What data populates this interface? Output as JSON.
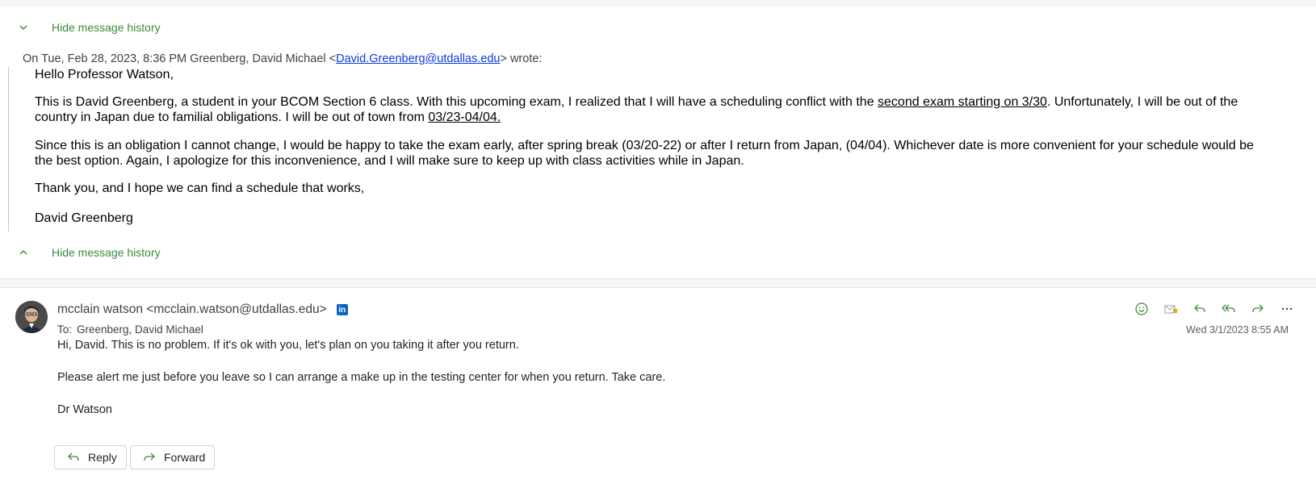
{
  "history": {
    "hide_label_top": "Hide message history",
    "hide_label_bottom": "Hide message history"
  },
  "quoted": {
    "header_prefix": "On Tue, Feb 28, 2023, 8:36 PM Greenberg, David Michael <",
    "header_email": "David.Greenberg@utdallas.edu",
    "header_suffix": "> wrote:",
    "greeting": "Hello Professor Watson,",
    "p1_a": "This is David Greenberg, a student in your BCOM Section 6 class. With this upcoming exam, I realized that I will have a scheduling conflict with the ",
    "p1_link": "second exam starting on 3/30",
    "p1_b": ". Unfortunately, I will be out of the country in Japan due to familial obligations. I will be out of town from ",
    "p1_dates": "03/23-04/04.",
    "p2": "Since this is an obligation I cannot change, I would be happy to take the exam early, after spring break (03/20-22) or after I return from Japan, (04/04). Whichever date is more convenient for your schedule would be the best option. Again, I apologize for this inconvenience, and I will make sure to keep up with class activities while in Japan.",
    "p3": "Thank you, and I hope we can find a schedule that works,",
    "signature": "David Greenberg"
  },
  "reply": {
    "sender": "mcclain watson <mcclain.watson@utdallas.edu>",
    "linkedin_icon": "in",
    "to_label": "To:",
    "to_value": "Greenberg, David Michael",
    "date": "Wed 3/1/2023 8:55 AM",
    "body": [
      "Hi, David. This is no problem. If it's ok with you, let's plan on you taking it after you return.",
      "Please alert me just before you leave so I can arrange a make up in the testing center for when you return. Take care.",
      "Dr Watson"
    ],
    "reply_button": "Reply",
    "forward_button": "Forward"
  },
  "icons": [
    "chevron-down-icon",
    "chevron-up-icon",
    "emoji-icon",
    "flag-mail-icon",
    "reply-icon",
    "reply-all-icon",
    "forward-icon",
    "more-icon",
    "linkedin-icon"
  ],
  "colors": {
    "accent_green": "#3f8a3a",
    "link_blue": "#0b3ae0",
    "linkedin_blue": "#0a66c2"
  }
}
